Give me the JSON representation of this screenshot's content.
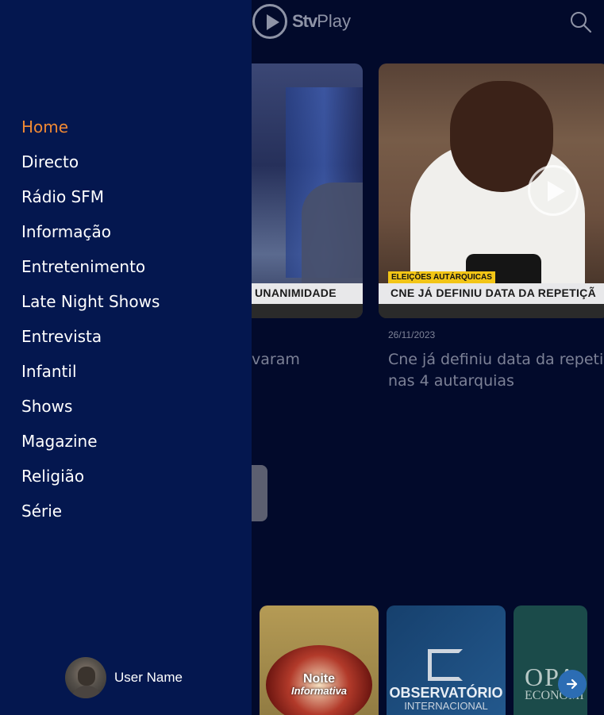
{
  "app": {
    "brand_strong": "Stv",
    "brand_light": "Play"
  },
  "colors": {
    "drawer_bg": "#04174f",
    "page_bg": "#020a2b",
    "active": "#f28a33",
    "text": "#ffffff"
  },
  "drawer": {
    "menu": [
      {
        "label": "Home",
        "active": true
      },
      {
        "label": "Directo",
        "active": false
      },
      {
        "label": "Rádio SFM",
        "active": false
      },
      {
        "label": "Informação",
        "active": false
      },
      {
        "label": "Entretenimento",
        "active": false
      },
      {
        "label": "Late Night Shows",
        "active": false
      },
      {
        "label": "Entrevista",
        "active": false
      },
      {
        "label": "Infantil",
        "active": false
      },
      {
        "label": "Shows",
        "active": false
      },
      {
        "label": "Magazine",
        "active": false
      },
      {
        "label": "Religião",
        "active": false
      },
      {
        "label": "Série",
        "active": false
      }
    ],
    "user": {
      "name": "User Name",
      "avatar_icon": "user-avatar"
    }
  },
  "cards": [
    {
      "lower_third": "UNANIMIDADE",
      "title_visible": "rovaram"
    },
    {
      "tag": "ELEIÇÕES AUTÁRQUICAS",
      "lower_third": "CNE JÁ DEFINIU DATA DA REPETIÇÃ",
      "date": "26/11/2023",
      "title_line1": "Cne já definiu data da repetiç",
      "title_line2": "nas 4 autarquias"
    }
  ],
  "thumbnails": [
    {
      "title": "Noite",
      "subtitle": "Informativa"
    },
    {
      "title": "OBSERVATÓRIO",
      "subtitle": "INTERNACIONAL"
    },
    {
      "title": "OPA",
      "subtitle": "ECONOMI"
    }
  ],
  "icons": {
    "search": "search-icon",
    "play": "play-icon",
    "next": "arrow-right-icon",
    "logo": "stv-logo-icon"
  }
}
